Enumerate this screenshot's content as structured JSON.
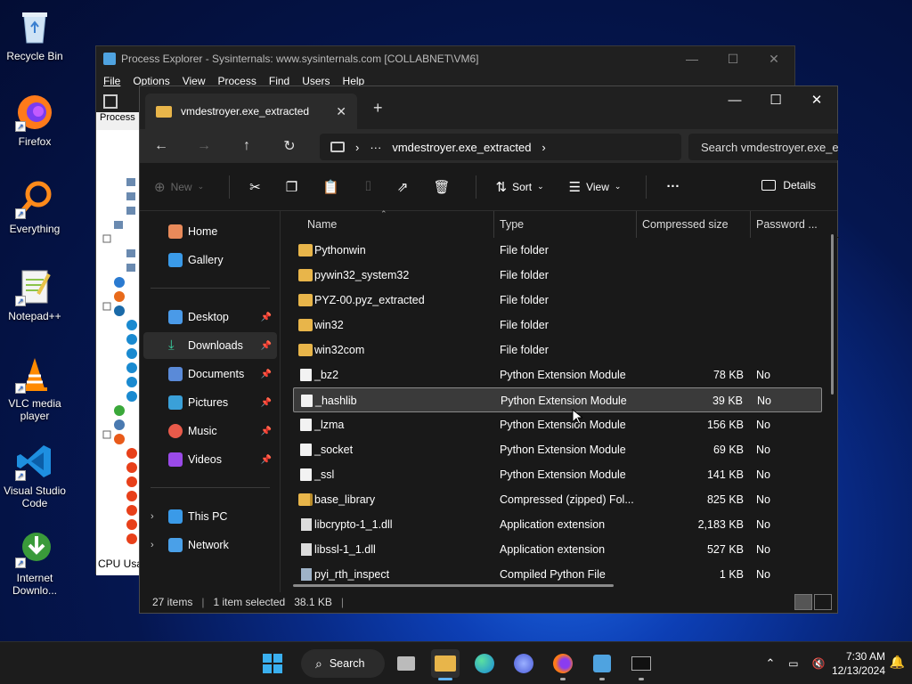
{
  "desktop": {
    "icons": [
      {
        "label": "Recycle Bin"
      },
      {
        "label": "Firefox"
      },
      {
        "label": "Everything"
      },
      {
        "label": "Notepad++"
      },
      {
        "label": "VLC media player"
      },
      {
        "label": "Visual Studio Code"
      },
      {
        "label": "Internet Downlo..."
      }
    ]
  },
  "procexp": {
    "title": "Process Explorer - Sysinternals: www.sysinternals.com [COLLABNET\\VM6]",
    "menu": [
      "File",
      "Options",
      "View",
      "Process",
      "Find",
      "Users",
      "Help"
    ],
    "tab": "Process",
    "status": "CPU Usa"
  },
  "explorer": {
    "tab_title": "vmdestroyer.exe_extracted",
    "address": {
      "more": "···",
      "folder": "vmdestroyer.exe_extracted"
    },
    "search_placeholder": "Search vmdestroyer.exe_e",
    "commands": {
      "new": "New",
      "sort": "Sort",
      "view": "View",
      "more": "···",
      "details": "Details"
    },
    "nav": {
      "home": "Home",
      "gallery": "Gallery",
      "desktop": "Desktop",
      "downloads": "Downloads",
      "documents": "Documents",
      "pictures": "Pictures",
      "music": "Music",
      "videos": "Videos",
      "thispc": "This PC",
      "network": "Network"
    },
    "columns": {
      "name": "Name",
      "type": "Type",
      "size": "Compressed size",
      "password": "Password ..."
    },
    "files": [
      {
        "name": "Pythonwin",
        "type": "File folder",
        "size": "",
        "pw": "",
        "kind": "folder"
      },
      {
        "name": "pywin32_system32",
        "type": "File folder",
        "size": "",
        "pw": "",
        "kind": "folder"
      },
      {
        "name": "PYZ-00.pyz_extracted",
        "type": "File folder",
        "size": "",
        "pw": "",
        "kind": "folder"
      },
      {
        "name": "win32",
        "type": "File folder",
        "size": "",
        "pw": "",
        "kind": "folder"
      },
      {
        "name": "win32com",
        "type": "File folder",
        "size": "",
        "pw": "",
        "kind": "folder"
      },
      {
        "name": "_bz2",
        "type": "Python Extension Module",
        "size": "78 KB",
        "pw": "No",
        "kind": "pyd"
      },
      {
        "name": "_hashlib",
        "type": "Python Extension Module",
        "size": "39 KB",
        "pw": "No",
        "kind": "pyd"
      },
      {
        "name": "_lzma",
        "type": "Python Extension Module",
        "size": "156 KB",
        "pw": "No",
        "kind": "pyd"
      },
      {
        "name": "_socket",
        "type": "Python Extension Module",
        "size": "69 KB",
        "pw": "No",
        "kind": "pyd"
      },
      {
        "name": "_ssl",
        "type": "Python Extension Module",
        "size": "141 KB",
        "pw": "No",
        "kind": "pyd"
      },
      {
        "name": "base_library",
        "type": "Compressed (zipped) Fol...",
        "size": "825 KB",
        "pw": "No",
        "kind": "zip"
      },
      {
        "name": "libcrypto-1_1.dll",
        "type": "Application extension",
        "size": "2,183 KB",
        "pw": "No",
        "kind": "dll"
      },
      {
        "name": "libssl-1_1.dll",
        "type": "Application extension",
        "size": "527 KB",
        "pw": "No",
        "kind": "dll"
      },
      {
        "name": "pyi_rth_inspect",
        "type": "Compiled Python File",
        "size": "1 KB",
        "pw": "No",
        "kind": "pyc"
      }
    ],
    "selected_index": 6,
    "status": {
      "items": "27 items",
      "selected": "1 item selected",
      "size": "38.1 KB"
    }
  },
  "taskbar": {
    "search_label": "Search",
    "time": "7:30 AM",
    "date": "12/13/2024"
  },
  "colors": {
    "folder": "#e8b54a",
    "accent": "#5fb2f2"
  }
}
